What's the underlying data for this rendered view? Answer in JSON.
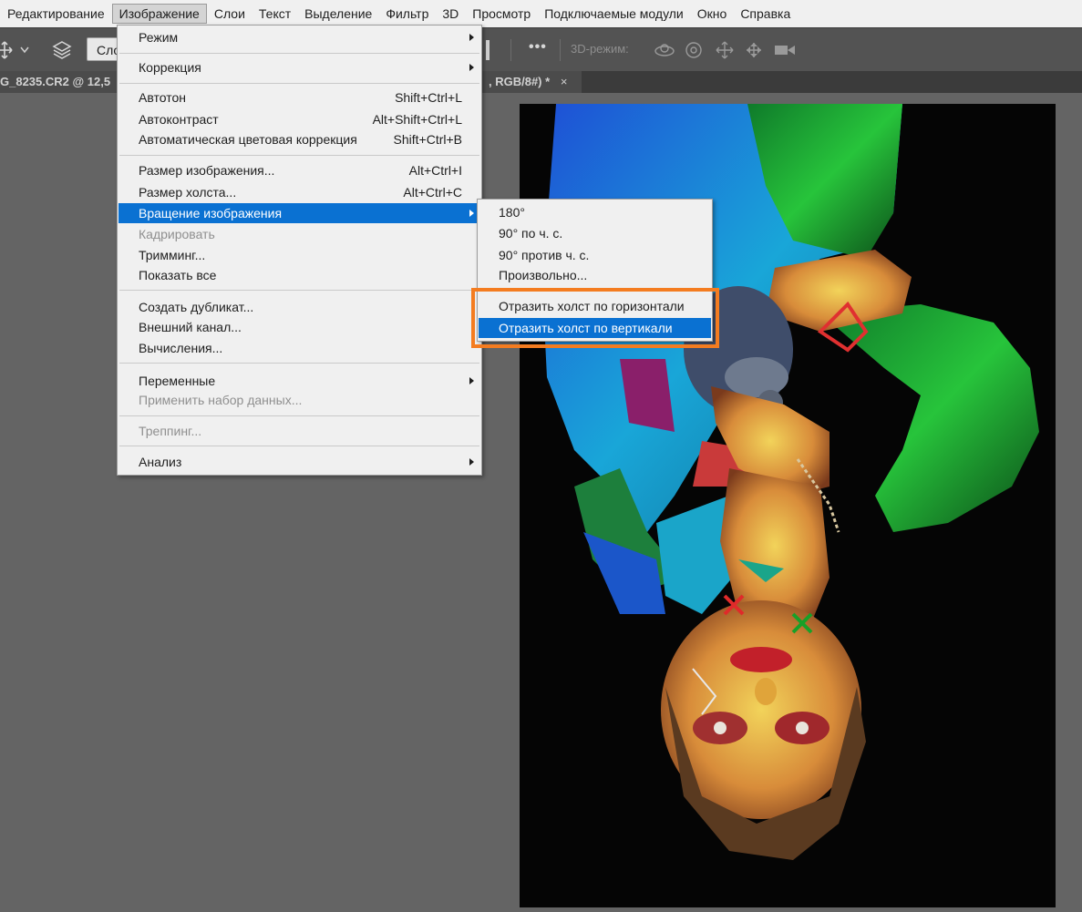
{
  "menubar": {
    "items": [
      "Редактирование",
      "Изображение",
      "Слои",
      "Текст",
      "Выделение",
      "Фильтр",
      "3D",
      "Просмотр",
      "Подключаемые модули",
      "Окно",
      "Справка"
    ],
    "active_index": 1
  },
  "options_bar": {
    "select_value": "Сло",
    "more_label": "•••",
    "mode_3d_label": "3D-режим:"
  },
  "tabs": {
    "tab1": "G_8235.CR2 @ 12,5",
    "tab2": ", RGB/8#) *",
    "close_glyph": "×"
  },
  "image_menu": {
    "items": [
      {
        "label": "Режим",
        "shortcut": "",
        "submenu": true,
        "disabled": false
      },
      {
        "label": "Коррекция",
        "shortcut": "",
        "submenu": true,
        "disabled": false
      },
      {
        "label": "Автотон",
        "shortcut": "Shift+Ctrl+L",
        "submenu": false,
        "disabled": false
      },
      {
        "label": "Автоконтраст",
        "shortcut": "Alt+Shift+Ctrl+L",
        "submenu": false,
        "disabled": false
      },
      {
        "label": "Автоматическая цветовая коррекция",
        "shortcut": "Shift+Ctrl+B",
        "submenu": false,
        "disabled": false
      },
      {
        "label": "Размер изображения...",
        "shortcut": "Alt+Ctrl+I",
        "submenu": false,
        "disabled": false
      },
      {
        "label": "Размер холста...",
        "shortcut": "Alt+Ctrl+C",
        "submenu": false,
        "disabled": false
      },
      {
        "label": "Вращение изображения",
        "shortcut": "",
        "submenu": true,
        "disabled": false,
        "highlighted": true
      },
      {
        "label": "Кадрировать",
        "shortcut": "",
        "submenu": false,
        "disabled": true
      },
      {
        "label": "Тримминг...",
        "shortcut": "",
        "submenu": false,
        "disabled": false
      },
      {
        "label": "Показать все",
        "shortcut": "",
        "submenu": false,
        "disabled": false
      },
      {
        "label": "Создать дубликат...",
        "shortcut": "",
        "submenu": false,
        "disabled": false
      },
      {
        "label": "Внешний канал...",
        "shortcut": "",
        "submenu": false,
        "disabled": false
      },
      {
        "label": "Вычисления...",
        "shortcut": "",
        "submenu": false,
        "disabled": false
      },
      {
        "label": "Переменные",
        "shortcut": "",
        "submenu": true,
        "disabled": false
      },
      {
        "label": "Применить набор данных...",
        "shortcut": "",
        "submenu": false,
        "disabled": true
      },
      {
        "label": "Треппинг...",
        "shortcut": "",
        "submenu": false,
        "disabled": true
      },
      {
        "label": "Анализ",
        "shortcut": "",
        "submenu": true,
        "disabled": false
      }
    ]
  },
  "rotation_submenu": {
    "items": [
      {
        "label": "180°",
        "highlighted": false
      },
      {
        "label": "90° по ч. с.",
        "highlighted": false
      },
      {
        "label": "90° против ч. с.",
        "highlighted": false
      },
      {
        "label": "Произвольно...",
        "highlighted": false
      },
      {
        "label": "Отразить холст по горизонтали",
        "highlighted": false
      },
      {
        "label": "Отразить холст по вертикали",
        "highlighted": true
      }
    ]
  },
  "colors": {
    "highlight": "#0a71d2",
    "callout": "#f47c20",
    "workspace": "#646464"
  }
}
